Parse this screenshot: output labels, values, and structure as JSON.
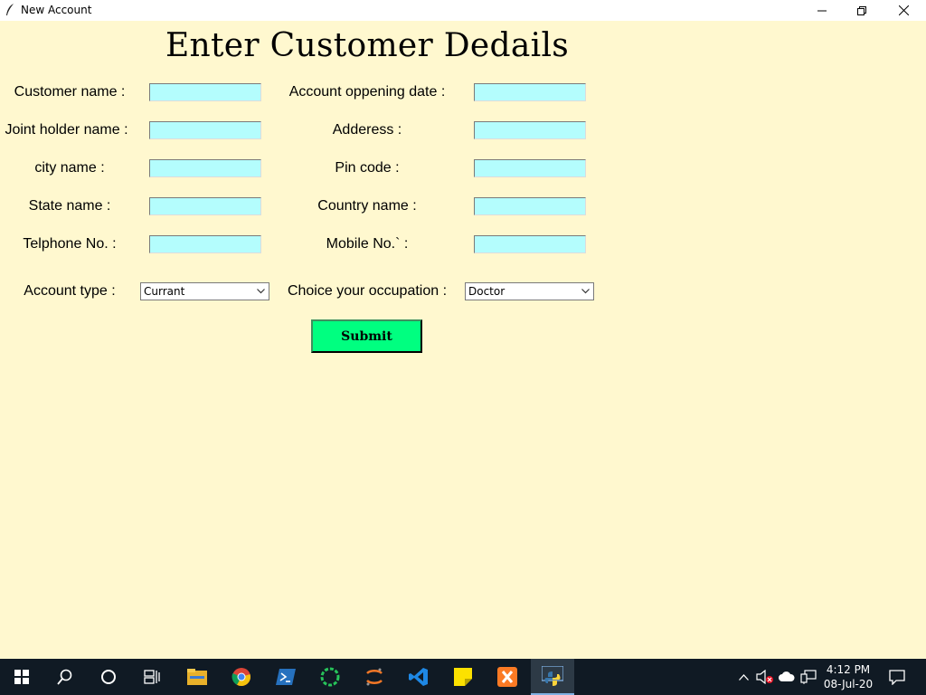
{
  "window": {
    "title": "New Account"
  },
  "form": {
    "heading": "Enter Customer Dedails",
    "left_fields": [
      {
        "label": "Customer name :",
        "value": ""
      },
      {
        "label": "Joint holder name :",
        "value": ""
      },
      {
        "label": "city name :",
        "value": ""
      },
      {
        "label": "State name :",
        "value": ""
      },
      {
        "label": "Telphone No. :",
        "value": ""
      }
    ],
    "right_fields": [
      {
        "label": "Account oppening date :",
        "value": ""
      },
      {
        "label": "Adderess :",
        "value": ""
      },
      {
        "label": "Pin code :",
        "value": ""
      },
      {
        "label": "Country name :",
        "value": ""
      },
      {
        "label": "Mobile No.` :",
        "value": ""
      }
    ],
    "account_type": {
      "label": "Account type :",
      "selected": "Currant"
    },
    "occupation": {
      "label": "Choice your occupation :",
      "selected": "Doctor"
    },
    "submit_label": "Submit"
  },
  "taskbar": {
    "time": "4:12 PM",
    "date": "08-Jul-20",
    "icons": [
      "windows-start-icon",
      "search-icon",
      "cortana-icon",
      "task-view-icon",
      "file-explorer-icon",
      "chrome-icon",
      "powershell-icon",
      "ring-app-icon",
      "jupyter-icon",
      "vscode-icon",
      "sticky-notes-icon",
      "xampp-icon",
      "python-idle-icon"
    ]
  },
  "colors": {
    "background": "#fff8cf",
    "entry": "#b4fdfd",
    "submit": "#00ff80",
    "taskbar": "#101a24"
  }
}
